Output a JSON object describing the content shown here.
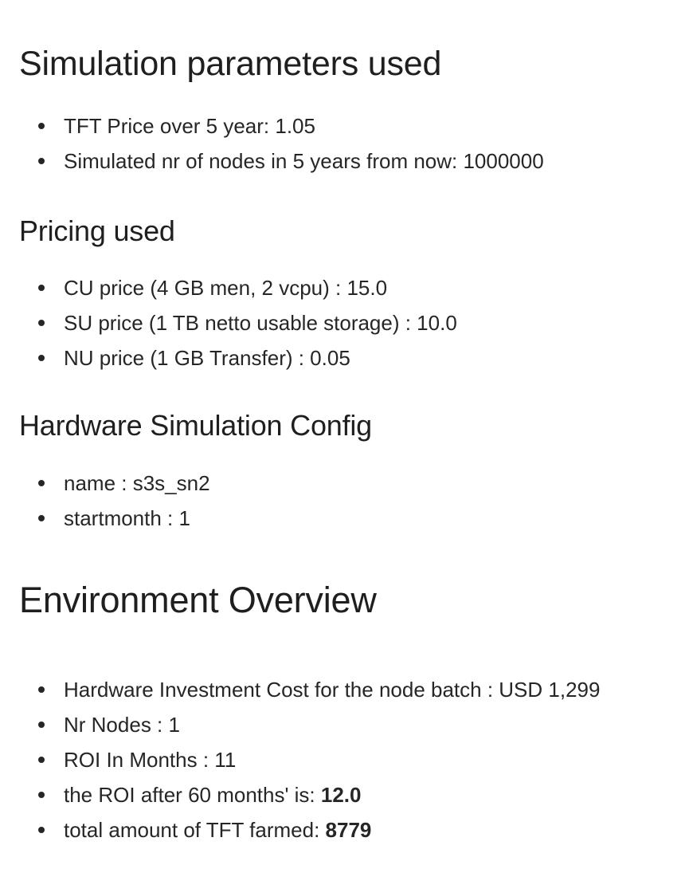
{
  "sections": {
    "simulation": {
      "heading": "Simulation parameters used",
      "items": [
        "TFT Price over 5 year: 1.05",
        "Simulated nr of nodes in 5 years from now: 1000000"
      ]
    },
    "pricing": {
      "heading": "Pricing used",
      "items": [
        "CU price (4 GB men, 2 vcpu) : 15.0",
        "SU price (1 TB netto usable storage) : 10.0",
        "NU price (1 GB Transfer) : 0.05"
      ]
    },
    "hardware": {
      "heading": "Hardware Simulation Config",
      "items": [
        "name : s3s_sn2",
        "startmonth : 1"
      ]
    },
    "environment": {
      "heading": "Environment Overview",
      "items": [
        "Hardware Investment Cost for the node batch : USD 1,299",
        "Nr Nodes : 1",
        "ROI In Months : 11"
      ],
      "roi_after_label": "the ROI after 60 months' is: ",
      "roi_after_value": "12.0",
      "tft_farmed_label": "total amount of TFT farmed: ",
      "tft_farmed_value": "8779"
    }
  }
}
